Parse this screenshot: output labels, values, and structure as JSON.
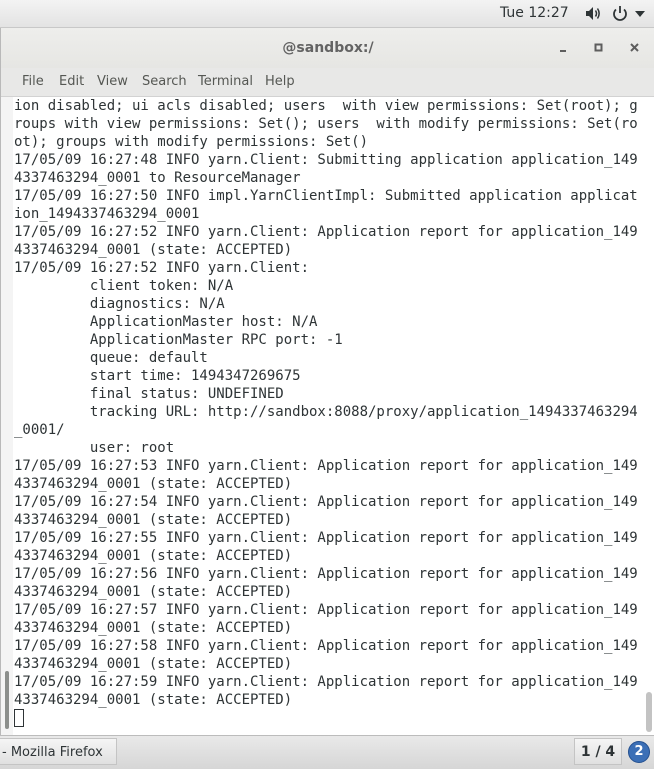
{
  "system": {
    "clock": "Tue 12:27"
  },
  "window": {
    "title": "@sandbox:/"
  },
  "menu": [
    "File",
    "Edit",
    "View",
    "Search",
    "Terminal",
    "Help"
  ],
  "terminal_lines": [
    "ion disabled; ui acls disabled; users  with view permissions: Set(root); g",
    "roups with view permissions: Set(); users  with modify permissions: Set(ro",
    "ot); groups with modify permissions: Set()",
    "17/05/09 16:27:48 INFO yarn.Client: Submitting application application_149",
    "4337463294_0001 to ResourceManager",
    "17/05/09 16:27:50 INFO impl.YarnClientImpl: Submitted application applicat",
    "ion_1494337463294_0001",
    "17/05/09 16:27:52 INFO yarn.Client: Application report for application_149",
    "4337463294_0001 (state: ACCEPTED)",
    "17/05/09 16:27:52 INFO yarn.Client:",
    "         client token: N/A",
    "         diagnostics: N/A",
    "         ApplicationMaster host: N/A",
    "         ApplicationMaster RPC port: -1",
    "         queue: default",
    "         start time: 1494347269675",
    "         final status: UNDEFINED",
    "         tracking URL: http://sandbox:8088/proxy/application_1494337463294",
    "_0001/",
    "         user: root",
    "17/05/09 16:27:53 INFO yarn.Client: Application report for application_149",
    "4337463294_0001 (state: ACCEPTED)",
    "17/05/09 16:27:54 INFO yarn.Client: Application report for application_149",
    "4337463294_0001 (state: ACCEPTED)",
    "17/05/09 16:27:55 INFO yarn.Client: Application report for application_149",
    "4337463294_0001 (state: ACCEPTED)",
    "17/05/09 16:27:56 INFO yarn.Client: Application report for application_149",
    "4337463294_0001 (state: ACCEPTED)",
    "17/05/09 16:27:57 INFO yarn.Client: Application report for application_149",
    "4337463294_0001 (state: ACCEPTED)",
    "17/05/09 16:27:58 INFO yarn.Client: Application report for application_149",
    "4337463294_0001 (state: ACCEPTED)",
    "17/05/09 16:27:59 INFO yarn.Client: Application report for application_149",
    "4337463294_0001 (state: ACCEPTED)"
  ],
  "taskbar": {
    "task_label": "- Mozilla Firefox",
    "workspace": "1 / 4",
    "notification_count": "2"
  },
  "icons": {
    "volume": "volume-icon",
    "power": "power-icon",
    "dropdown": "chevron-down-icon",
    "minimize": "minimize-icon",
    "maximize": "maximize-icon",
    "close": "close-icon"
  }
}
